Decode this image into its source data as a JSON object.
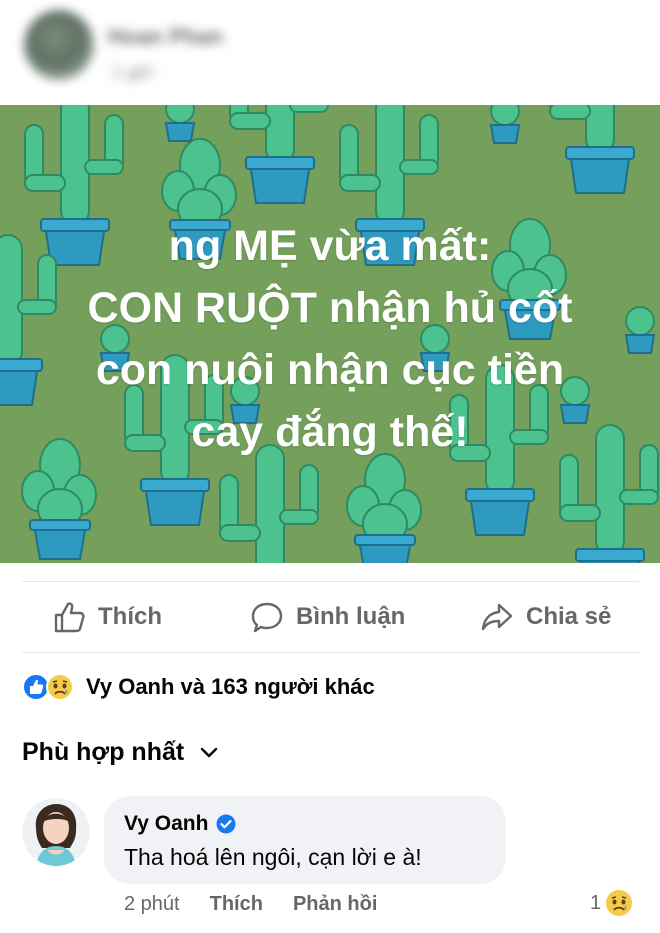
{
  "header": {
    "author_name": "Hoan Phan",
    "timestamp": "1 giờ · "
  },
  "post": {
    "background_color": "#74a05c",
    "text_lines": [
      "ng MẸ vừa mất:",
      "CON RUỘT nhận hủ cốt",
      "con nuôi nhận cục tiền",
      "cay đắng thế!"
    ]
  },
  "actions": {
    "like_label": "Thích",
    "comment_label": "Bình luận",
    "share_label": "Chia sẻ"
  },
  "reactions": {
    "icons": [
      "like-icon",
      "sad-icon"
    ],
    "summary": "Vy Oanh và 163 người khác"
  },
  "sort": {
    "label": "Phù hợp nhất"
  },
  "comment": {
    "author": "Vy Oanh",
    "verified": true,
    "text": "Tha hoá lên ngôi, cạn lời e à!",
    "time": "2 phút",
    "like_label": "Thích",
    "reply_label": "Phản hồi",
    "reaction_count": "1",
    "reaction_icon": "sad-icon"
  },
  "colors": {
    "accent": "#1877f2",
    "secondary_text": "#65676b",
    "bubble": "#f0f2f5"
  }
}
